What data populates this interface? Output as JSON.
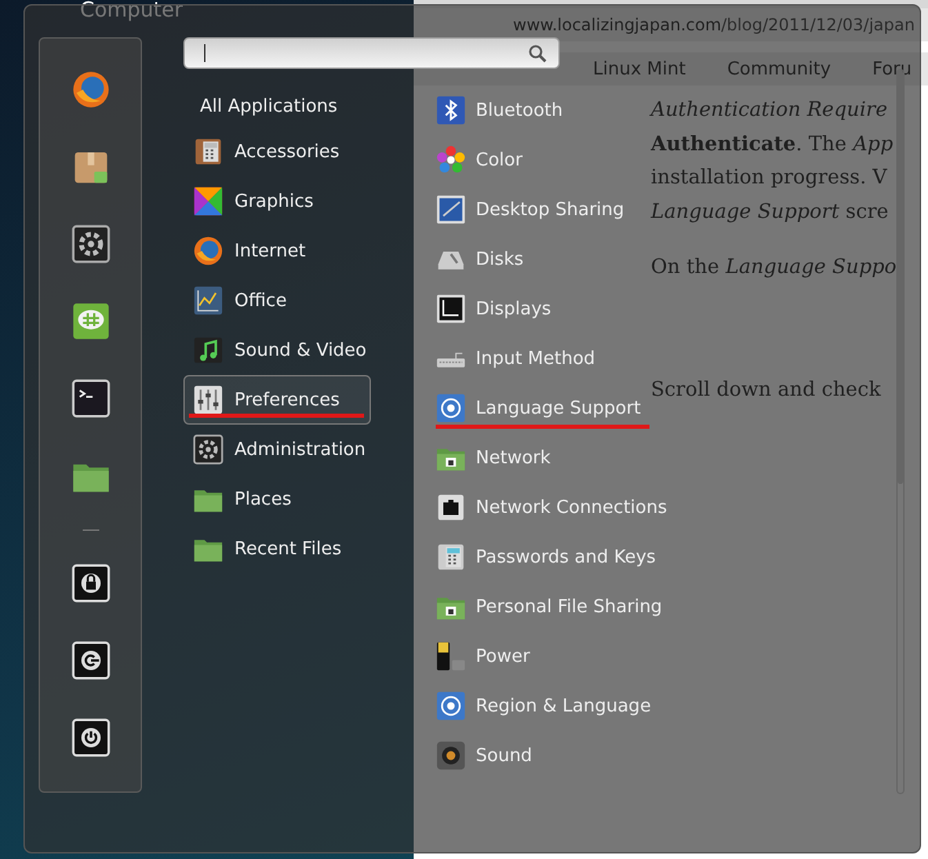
{
  "desktop": {
    "icon_labels": [
      "Computer"
    ]
  },
  "browser": {
    "url_host": "www.localizingjapan.com",
    "url_path": "/blog/2011/12/03/japan",
    "bookmarks": [
      "Linux Mint",
      "Community",
      "Foru"
    ],
    "paragraphs": [
      {
        "lines": [
          {
            "text": "Authentication Require",
            "italic": true
          },
          {
            "text": "**Authenticate**. The *App*",
            "italic": false
          },
          {
            "text": "installation progress. V",
            "italic": false
          },
          {
            "text": "*Language Support* scre",
            "italic": false
          }
        ]
      },
      {
        "lines": [
          {
            "text": "On the *Language Suppo*",
            "italic": false
          }
        ]
      },
      {
        "lines": [
          {
            "text": "Scroll down and check",
            "italic": false
          }
        ]
      }
    ]
  },
  "categories": [
    {
      "label": "All Applications",
      "selected": false,
      "underlined": false
    },
    {
      "label": "Accessories",
      "selected": false,
      "underlined": false
    },
    {
      "label": "Graphics",
      "selected": false,
      "underlined": false
    },
    {
      "label": "Internet",
      "selected": false,
      "underlined": false
    },
    {
      "label": "Office",
      "selected": false,
      "underlined": false
    },
    {
      "label": "Sound & Video",
      "selected": false,
      "underlined": false
    },
    {
      "label": "Preferences",
      "selected": true,
      "underlined": true
    },
    {
      "label": "Administration",
      "selected": false,
      "underlined": false
    },
    {
      "label": "Places",
      "selected": false,
      "underlined": false
    },
    {
      "label": "Recent Files",
      "selected": false,
      "underlined": false
    }
  ],
  "applications": [
    {
      "label": "Bluetooth",
      "underlined": false
    },
    {
      "label": "Color",
      "underlined": false
    },
    {
      "label": "Desktop Sharing",
      "underlined": false
    },
    {
      "label": "Disks",
      "underlined": false
    },
    {
      "label": "Displays",
      "underlined": false
    },
    {
      "label": "Input Method",
      "underlined": false
    },
    {
      "label": "Language Support",
      "underlined": true
    },
    {
      "label": "Network",
      "underlined": false
    },
    {
      "label": "Network Connections",
      "underlined": false
    },
    {
      "label": "Passwords and Keys",
      "underlined": false
    },
    {
      "label": "Personal File Sharing",
      "underlined": false
    },
    {
      "label": "Power",
      "underlined": false
    },
    {
      "label": "Region & Language",
      "underlined": false
    },
    {
      "label": "Sound",
      "underlined": false
    }
  ]
}
